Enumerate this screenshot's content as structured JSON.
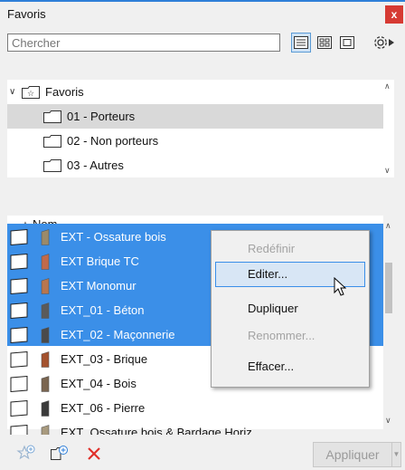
{
  "window": {
    "title": "Favoris",
    "close_label": "x"
  },
  "search": {
    "placeholder": "Chercher",
    "value": ""
  },
  "tree": {
    "root_label": "Favoris",
    "items": [
      {
        "label": "01 - Porteurs",
        "selected": true
      },
      {
        "label": "02 - Non porteurs",
        "selected": false
      },
      {
        "label": "03 - Autres",
        "selected": false
      }
    ]
  },
  "list": {
    "column_header": "Nom",
    "rows": [
      {
        "name": "EXT - Ossature bois",
        "selected": true,
        "color": "#9b8a6a"
      },
      {
        "name": "EXT Brique TC",
        "selected": true,
        "color": "#c06a4a"
      },
      {
        "name": "EXT Monomur",
        "selected": true,
        "color": "#b8764e"
      },
      {
        "name": "EXT_01 - Béton",
        "selected": true,
        "color": "#5a5a5a"
      },
      {
        "name": "EXT_02 - Maçonnerie",
        "selected": true,
        "color": "#4a4a4a"
      },
      {
        "name": "EXT_03 - Brique",
        "selected": false,
        "color": "#a4522e"
      },
      {
        "name": "EXT_04 - Bois",
        "selected": false,
        "color": "#7a6550"
      },
      {
        "name": "EXT_06 - Pierre",
        "selected": false,
        "color": "#3a3a3a"
      },
      {
        "name": "EXT_Ossature bois & Bardage Horiz",
        "selected": false,
        "color": "#a89a7e"
      }
    ]
  },
  "context_menu": {
    "items": [
      {
        "label": "Redéfinir",
        "disabled": true
      },
      {
        "label": "Editer...",
        "disabled": false,
        "hover": true
      },
      {
        "label": "Dupliquer",
        "disabled": false
      },
      {
        "label": "Renommer...",
        "disabled": true
      },
      {
        "label": "Effacer...",
        "disabled": false
      }
    ]
  },
  "bottom": {
    "apply_label": "Appliquer"
  },
  "colors": {
    "accent": "#2f7fd8",
    "selection": "#3b8fe8",
    "close": "#d63a33",
    "delete": "#e0302a"
  }
}
